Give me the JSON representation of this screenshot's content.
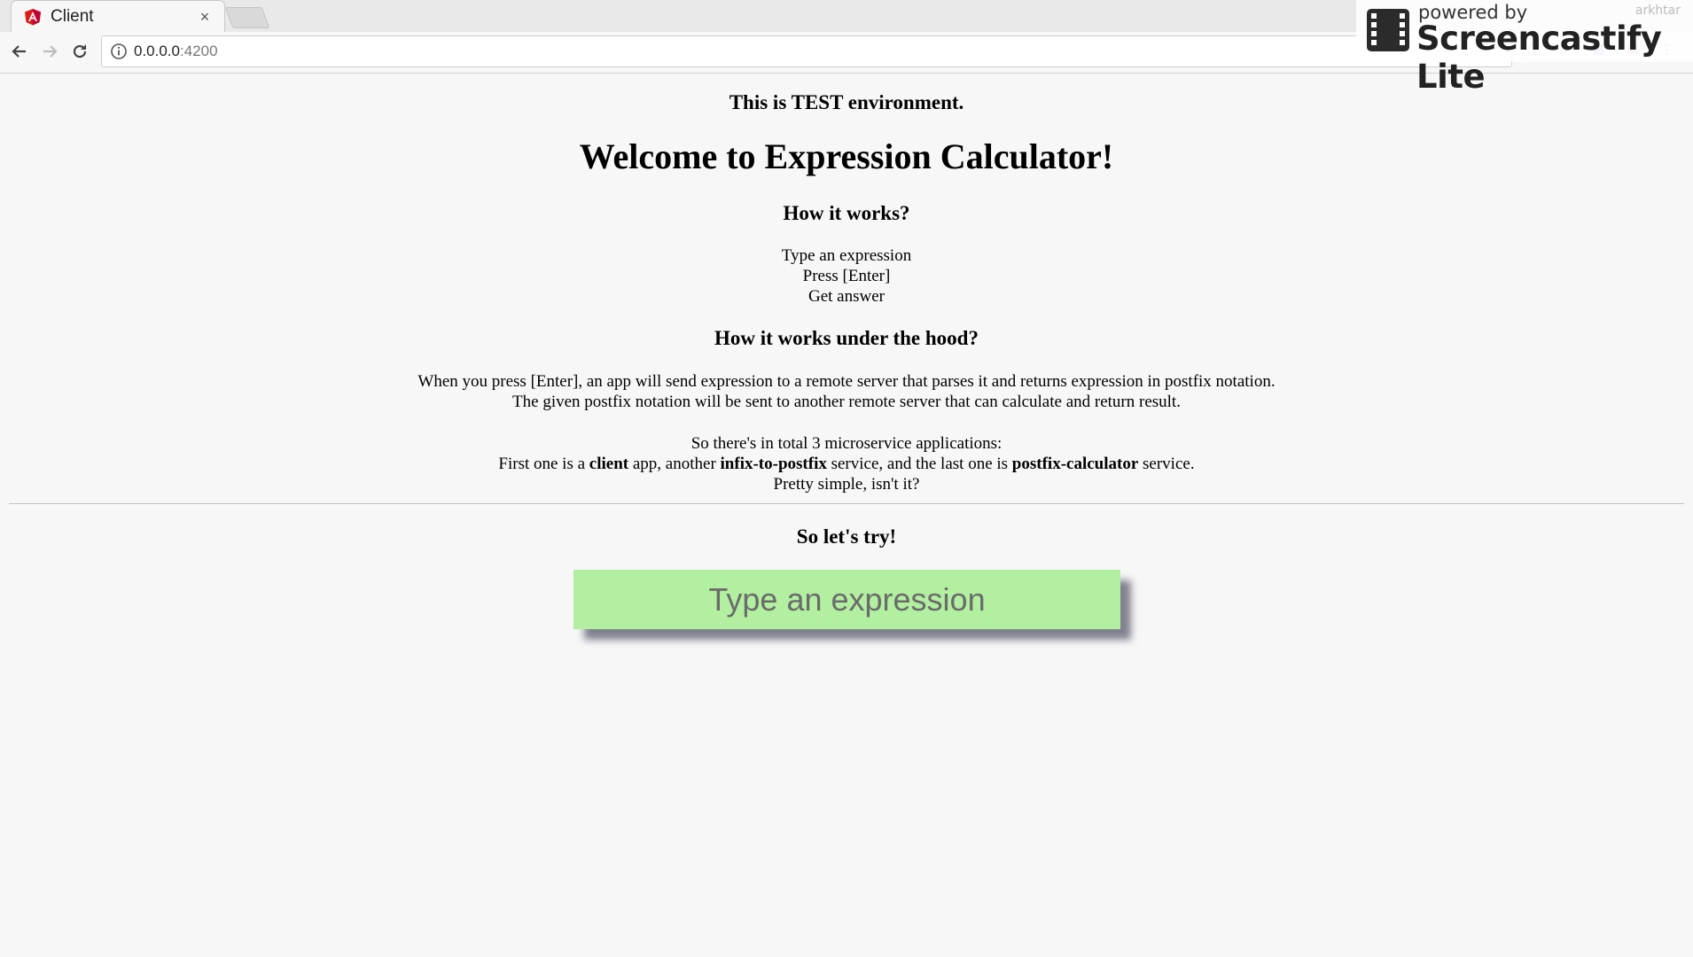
{
  "browser": {
    "tab_title": "Client",
    "tab_close": "×",
    "url_host": "0.0.0.0",
    "url_port": ":4200"
  },
  "watermark": {
    "powered_by": "powered by",
    "brand": "Screencastify Lite",
    "user": "arkhtar"
  },
  "page": {
    "environment_notice": "This is TEST environment.",
    "title": "Welcome to Expression Calculator!",
    "how_heading": "How it works?",
    "steps": [
      "Type an expression",
      "Press [Enter]",
      "Get answer"
    ],
    "hood_heading": "How it works under the hood?",
    "hood_lines": [
      "When you press [Enter], an app will send expression to a remote server that parses it and returns expression in postfix notation.",
      "The given postfix notation will be sent to another remote server that can calculate and return result."
    ],
    "micro_intro": "So there's in total 3 microservice applications:",
    "micro_line": {
      "p1": "First one is a ",
      "b1": "client",
      "p2": " app, another ",
      "b2": "infix-to-postfix",
      "p3": " service, and the last one is ",
      "b3": "postfix-calculator",
      "p4": " service."
    },
    "micro_outro": "Pretty simple, isn't it?",
    "try_heading": "So let's try!",
    "input_placeholder": "Type an expression",
    "input_value": ""
  },
  "colors": {
    "input_bg": "#b2efa0",
    "favicon": "#dd1b16"
  }
}
